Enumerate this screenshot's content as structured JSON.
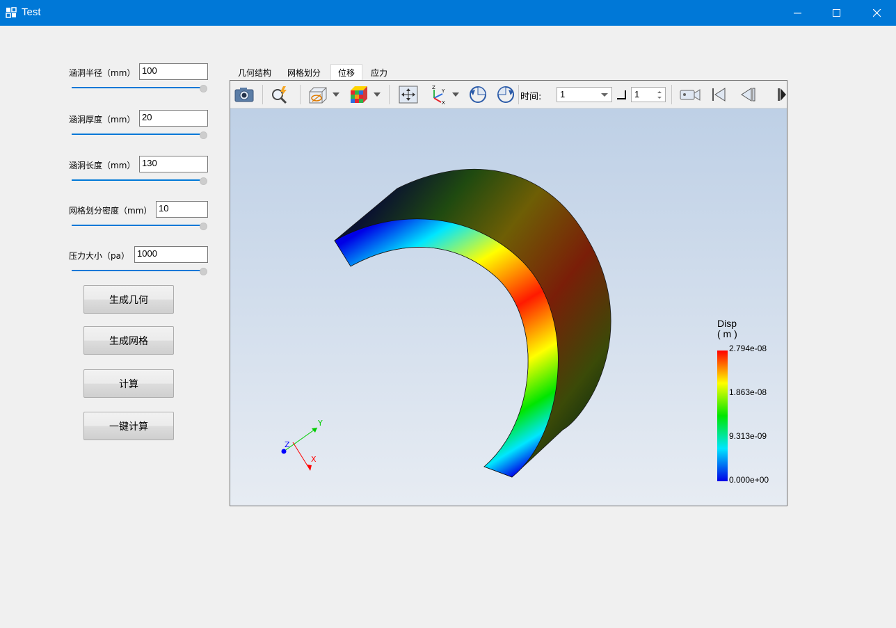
{
  "window": {
    "title": "Test",
    "accent_color": "#0078d7"
  },
  "params": [
    {
      "label": "涵洞半径（mm）",
      "value": "100",
      "slider_fraction": 1.0
    },
    {
      "label": "涵洞厚度（mm）",
      "value": "20",
      "slider_fraction": 1.0
    },
    {
      "label": "涵洞长度（mm）",
      "value": "130",
      "slider_fraction": 1.0
    },
    {
      "label": "网格划分密度（mm）",
      "value": "10",
      "slider_fraction": 1.0
    },
    {
      "label": "压力大小（pa）",
      "value": "1000",
      "slider_fraction": 1.0
    }
  ],
  "buttons": {
    "generate_geometry": "生成几何",
    "generate_mesh": "生成网格",
    "compute": "计算",
    "one_click_compute": "一键计算"
  },
  "tabs": [
    {
      "label": "几何结构",
      "active": false
    },
    {
      "label": "网格划分",
      "active": false
    },
    {
      "label": "位移",
      "active": true
    },
    {
      "label": "应力",
      "active": false
    }
  ],
  "toolbar": {
    "icons": [
      "camera-icon",
      "zoom-flash-icon",
      "surface-style-icon",
      "cube-color-icon",
      "fit-view-icon",
      "axes-orient-icon",
      "rotate-ccw-icon",
      "rotate-cw-icon",
      "video-camera-icon",
      "first-frame-icon",
      "previous-frame-icon",
      "next-frame-icon"
    ],
    "time_label": "时间:",
    "time_value": "1",
    "frame_value": "1"
  },
  "legend": {
    "title_line1": "Disp",
    "title_line2": "( m )",
    "ticks": [
      "2.794e-08",
      "1.863e-08",
      "9.313e-09",
      "0.000e+00"
    ]
  },
  "axes": {
    "x": "X",
    "y": "Y",
    "z": "Z"
  }
}
